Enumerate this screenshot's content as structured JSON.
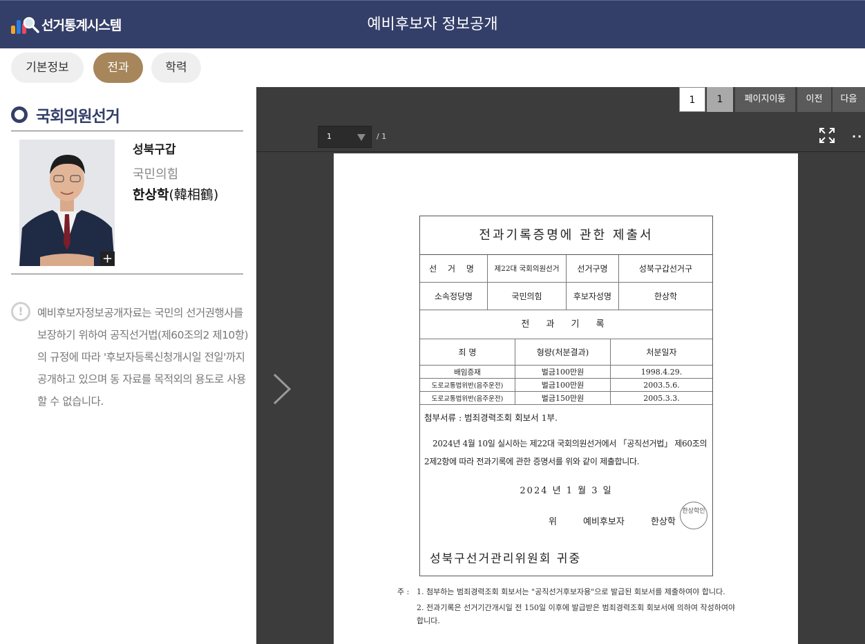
{
  "header": {
    "logo_text": "선거통계시스템",
    "title": "예비후보자 정보공개"
  },
  "tabs": [
    {
      "label": "기본정보"
    },
    {
      "label": "전과"
    },
    {
      "label": "학력"
    }
  ],
  "candidate": {
    "section_title": "국회의원선거",
    "district": "성북구갑",
    "party": "국민의힘",
    "name": "한상학",
    "name_hanja": "(韓相鶴)",
    "photo_expand": "+"
  },
  "notice_icon": "!",
  "notice_text": "예비후보자정보공개자료는 국민의 선거권행사를 보장하기 위하여 공직선거법(제60조의2 제10항)의 규정에 따라 '후보자등록신청개시일 전일'까지 공개하고 있으며 동 자료를 목적외의 용도로 사용할 수 없습니다.",
  "viewer": {
    "page_input": "1",
    "page_current": "1",
    "go_label": "페이지이동",
    "prev_label": "이전",
    "next_label": "다음",
    "page_select": "1",
    "page_total": "/ 1",
    "more": "··"
  },
  "document": {
    "title": "전과기록증명에 관한 제출서",
    "row1": {
      "l1": "선 거 명",
      "v1": "제22대 국회의원선거",
      "l2": "선거구명",
      "v2": "성북구갑선거구"
    },
    "row2": {
      "l1": "소속정당명",
      "v1": "국민의힘",
      "l2": "후보자성명",
      "v2": "한상학"
    },
    "crime_title": "전 과 기 록",
    "columns": {
      "c1": "죄 명",
      "c2": "형량(처분결과)",
      "c3": "처분일자"
    },
    "records": [
      {
        "crime": "배임증재",
        "penalty": "벌금100만원",
        "date": "1998.4.29."
      },
      {
        "crime": "도로교통법위반(음주운전)",
        "penalty": "벌금100만원",
        "date": "2003.5.6."
      },
      {
        "crime": "도로교통법위반(음주운전)",
        "penalty": "벌금150만원",
        "date": "2005.3.3."
      }
    ],
    "attach": "첨부서류 : 범죄경력조회 회보서 1부.",
    "statement": "2024년 4월 10일 실시하는 제22대 국회의원선거에서 「공직선거법」 제60조의2제2항에 따라 전과기록에 관한 증명서를 위와 같이 제출합니다.",
    "date": "2024 년 1 월 3 일",
    "sign_prefix": "위",
    "sign_role": "예비후보자",
    "sign_name": "한상학",
    "seal": "한상학인",
    "commission": "성북구선거관리위원회 귀중",
    "note_prefix": "주 :",
    "note1": "1. 첨부하는 범죄경력조회 회보서는 \"공직선거후보자용\"으로 발급된 회보서를 제출하여야 합니다.",
    "note2": "2. 전과기록은 선거기간개시일 전 150일 이후에 발급받은 범죄경력조회 회보서에 의하여 작성하여야 합니다."
  },
  "colors": {
    "header_bg": "#343f69",
    "tab_active": "#a6865a",
    "viewer_bg": "#3c3c3c"
  }
}
